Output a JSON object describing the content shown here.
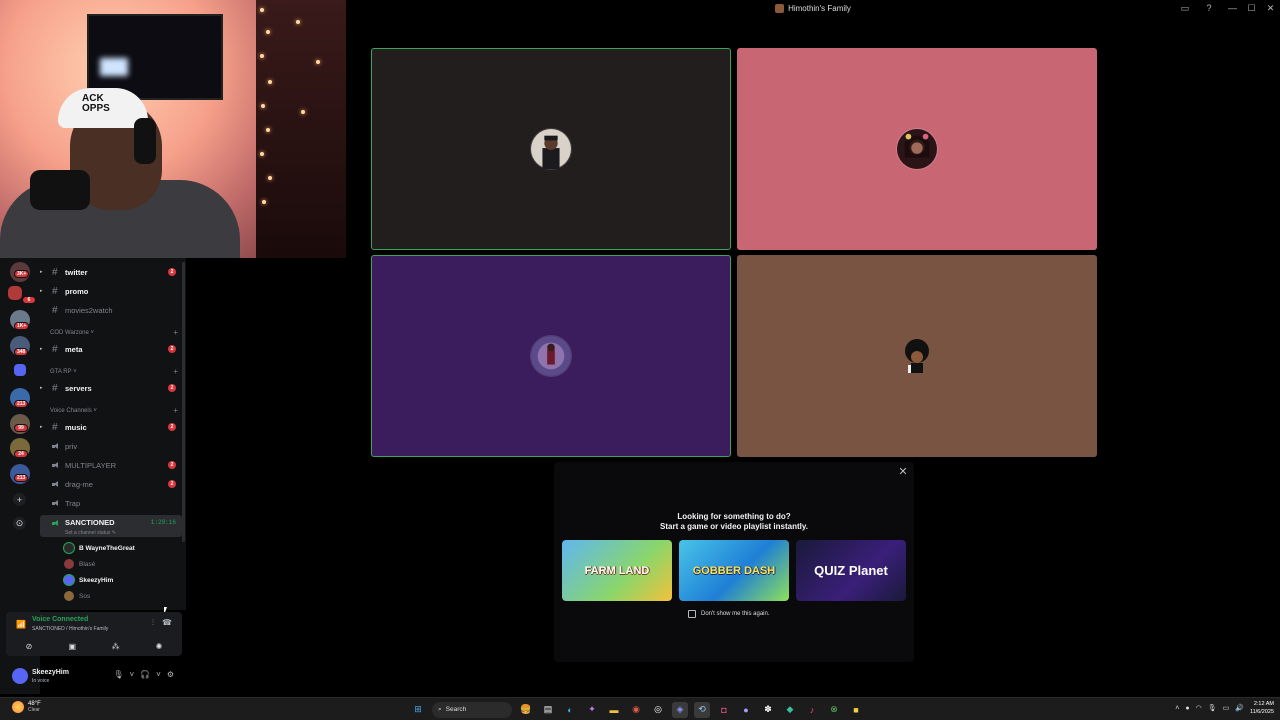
{
  "window": {
    "title": "Himothin's Family",
    "controls": [
      "—",
      "☐",
      "✕"
    ]
  },
  "webcam": {
    "hat_text_line1": "ACK",
    "hat_text_line2": "OPPS"
  },
  "call_tiles": [
    {
      "label": "participant-1",
      "bg": "#221e1d",
      "speaking": true,
      "avatar_color": "#e6e0d8"
    },
    {
      "label": "participant-2",
      "bg": "#c86674",
      "speaking": false,
      "avatar_color": "#3a1e22"
    },
    {
      "label": "participant-3",
      "bg": "#3b1c5c",
      "speaking": true,
      "avatar_color": "#8a6aa8"
    },
    {
      "label": "participant-4",
      "bg": "#7a5443",
      "speaking": false,
      "avatar_color": "#1a1a1a"
    }
  ],
  "activity_popup": {
    "heading": "Looking for something to do?",
    "subheading": "Start a game or video playlist instantly.",
    "games": [
      {
        "name": "FARM LAND",
        "colors": [
          "#5fb7f0",
          "#f3c13a"
        ]
      },
      {
        "name": "GOBBER DASH",
        "colors": [
          "#48c4e8",
          "#1f7fd6"
        ]
      },
      {
        "name": "QUIZ Planet",
        "colors": [
          "#1a1a3a",
          "#2a1f6a"
        ]
      }
    ],
    "checkbox_label": "Don't show me this again.",
    "close": "✕"
  },
  "guild_badges": [
    "3K+",
    "6",
    "1K+",
    "348",
    "213",
    "99",
    "24",
    "213"
  ],
  "channels": {
    "text": [
      {
        "name": "twitter",
        "bold": true,
        "ping": "2"
      },
      {
        "name": "promo",
        "bold": true,
        "ping": ""
      },
      {
        "name": "movies2watch",
        "bold": false,
        "ping": ""
      }
    ],
    "cat_cod": "COD Warzone",
    "cod": [
      {
        "name": "meta",
        "bold": true,
        "ping": "2"
      }
    ],
    "cat_gta": "GTA RP",
    "gta": [
      {
        "name": "servers",
        "bold": true,
        "ping": "2"
      }
    ],
    "cat_voice": "Voice Channels",
    "voice_text": [
      {
        "name": "music",
        "bold": true,
        "ping": "2"
      }
    ],
    "voice": [
      {
        "name": "priv",
        "bold": false,
        "ping": ""
      },
      {
        "name": "MULTIPLAYER",
        "bold": false,
        "ping": "2"
      },
      {
        "name": "drag-me",
        "bold": false,
        "ping": "2"
      },
      {
        "name": "Trap",
        "bold": false,
        "ping": ""
      }
    ],
    "active_voice": {
      "name": "SANCTIONED",
      "timer": "1:29:16",
      "status": "Set a channel status"
    },
    "members": [
      {
        "name": "B WayneTheGreat",
        "dim": false,
        "ring": true
      },
      {
        "name": "Blasé",
        "dim": true,
        "ring": false
      },
      {
        "name": "SkeezyHim",
        "dim": false,
        "ring": true
      },
      {
        "name": "Sos",
        "dim": true,
        "ring": false
      }
    ]
  },
  "voice_panel": {
    "title": "Voice Connected",
    "subtitle": "SANCTIONED / Himothin's Family"
  },
  "user_panel": {
    "name": "SkeezyHim",
    "status": "In voice"
  },
  "taskbar": {
    "temp": "48°F",
    "weather": "Clear",
    "search": "Search",
    "time": "2:12 AM",
    "date": "11/6/2025"
  }
}
